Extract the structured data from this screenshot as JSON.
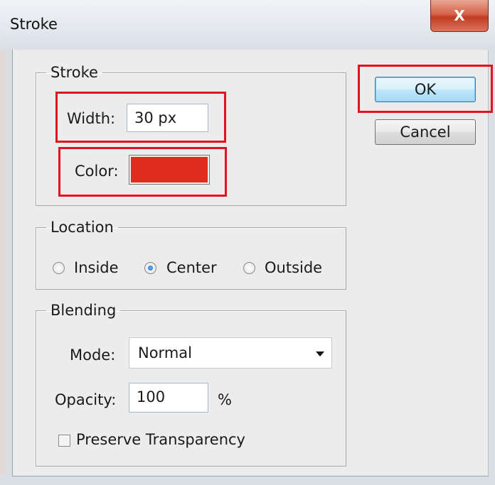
{
  "window": {
    "title": "Stroke",
    "close_glyph": "X"
  },
  "stroke_group": {
    "legend": "Stroke",
    "width_label": "Width:",
    "width_value": "30 px",
    "color_label": "Color:",
    "color_value": "#e02c1e"
  },
  "location_group": {
    "legend": "Location",
    "options": [
      {
        "label": "Inside",
        "selected": false
      },
      {
        "label": "Center",
        "selected": true
      },
      {
        "label": "Outside",
        "selected": false
      }
    ]
  },
  "blending_group": {
    "legend": "Blending",
    "mode_label": "Mode:",
    "mode_value": "Normal",
    "opacity_label": "Opacity:",
    "opacity_value": "100",
    "opacity_unit": "%",
    "preserve_label": "Preserve Transparency",
    "preserve_checked": false
  },
  "buttons": {
    "ok": "OK",
    "cancel": "Cancel"
  },
  "highlight_color": "#e0141e"
}
